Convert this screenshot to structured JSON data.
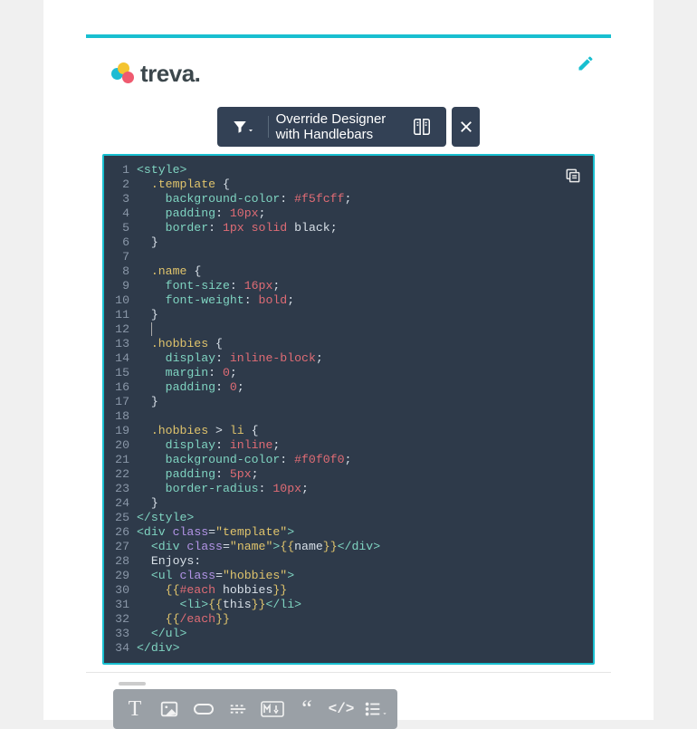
{
  "brand": {
    "name": "treva."
  },
  "pill": {
    "label": "Override Designer with Handlebars"
  },
  "code": {
    "line_count": 34,
    "lines_html": [
      "<span class='t-tag'>&lt;style&gt;</span>",
      "<span class='t-sel'>  .template</span><span class='t-punc'> {</span>",
      "<span class='t-prop'>    background-color</span><span class='t-punc'>: </span><span class='t-val'>#f5fcff</span><span class='t-punc'>;</span>",
      "<span class='t-prop'>    padding</span><span class='t-punc'>: </span><span class='t-val'>10px</span><span class='t-punc'>;</span>",
      "<span class='t-prop'>    border</span><span class='t-punc'>: </span><span class='t-val'>1px</span><span class='t-punc'> </span><span class='t-val'>solid</span><span class='t-punc'> black;</span>",
      "<span class='t-punc'>  }</span>",
      "",
      "<span class='t-sel'>  .name</span><span class='t-punc'> {</span>",
      "<span class='t-prop'>    font-size</span><span class='t-punc'>: </span><span class='t-val'>16px</span><span class='t-punc'>;</span>",
      "<span class='t-prop'>    font-weight</span><span class='t-punc'>: </span><span class='t-val'>bold</span><span class='t-punc'>;</span>",
      "<span class='t-punc'>  }</span>",
      "  <span style='border-left:1px solid #aaa;'></span>",
      "<span class='t-sel'>  .hobbies</span><span class='t-punc'> {</span>",
      "<span class='t-prop'>    display</span><span class='t-punc'>: </span><span class='t-val'>inline-block</span><span class='t-punc'>;</span>",
      "<span class='t-prop'>    margin</span><span class='t-punc'>: </span><span class='t-val'>0</span><span class='t-punc'>;</span>",
      "<span class='t-prop'>    padding</span><span class='t-punc'>: </span><span class='t-val'>0</span><span class='t-punc'>;</span>",
      "<span class='t-punc'>  }</span>",
      "",
      "<span class='t-sel'>  .hobbies</span><span class='t-punc'> &gt; </span><span class='t-sel'>li</span><span class='t-punc'> {</span>",
      "<span class='t-prop'>    display</span><span class='t-punc'>: </span><span class='t-val'>inline</span><span class='t-punc'>;</span>",
      "<span class='t-prop'>    background-color</span><span class='t-punc'>: </span><span class='t-val'>#f0f0f0</span><span class='t-punc'>;</span>",
      "<span class='t-prop'>    padding</span><span class='t-punc'>: </span><span class='t-val'>5px</span><span class='t-punc'>;</span>",
      "<span class='t-prop'>    border-radius</span><span class='t-punc'>: </span><span class='t-val'>10px</span><span class='t-punc'>;</span>",
      "<span class='t-punc'>  }</span>",
      "<span class='t-tag'>&lt;/style&gt;</span>",
      "<span class='t-tag'>&lt;div</span> <span class='t-attr'>class</span><span class='t-punc'>=</span><span class='t-str'>\"template\"</span><span class='t-tag'>&gt;</span>",
      "  <span class='t-tag'>&lt;div</span> <span class='t-attr'>class</span><span class='t-punc'>=</span><span class='t-str'>\"name\"</span><span class='t-tag'>&gt;</span><span class='t-hbs'>{{</span><span class='t-punc'>name</span><span class='t-hbs'>}}</span><span class='t-tag'>&lt;/div&gt;</span>",
      "  <span class='t-punc'>Enjoys:</span>",
      "  <span class='t-tag'>&lt;ul</span> <span class='t-attr'>class</span><span class='t-punc'>=</span><span class='t-str'>\"hobbies\"</span><span class='t-tag'>&gt;</span>",
      "    <span class='t-hbs'>{{</span><span class='t-hbsk'>#each</span> <span class='t-punc'>hobbies</span><span class='t-hbs'>}}</span>",
      "      <span class='t-tag'>&lt;li&gt;</span><span class='t-hbs'>{{</span><span class='t-punc'>this</span><span class='t-hbs'>}}</span><span class='t-tag'>&lt;/li&gt;</span>",
      "    <span class='t-hbs'>{{</span><span class='t-hbsk'>/each</span><span class='t-hbs'>}}</span>",
      "  <span class='t-tag'>&lt;/ul&gt;</span>",
      "<span class='t-tag'>&lt;/div&gt;</span>"
    ]
  },
  "bottom_tools": [
    "text",
    "image",
    "button",
    "divider",
    "markdown",
    "quote",
    "code",
    "list"
  ]
}
